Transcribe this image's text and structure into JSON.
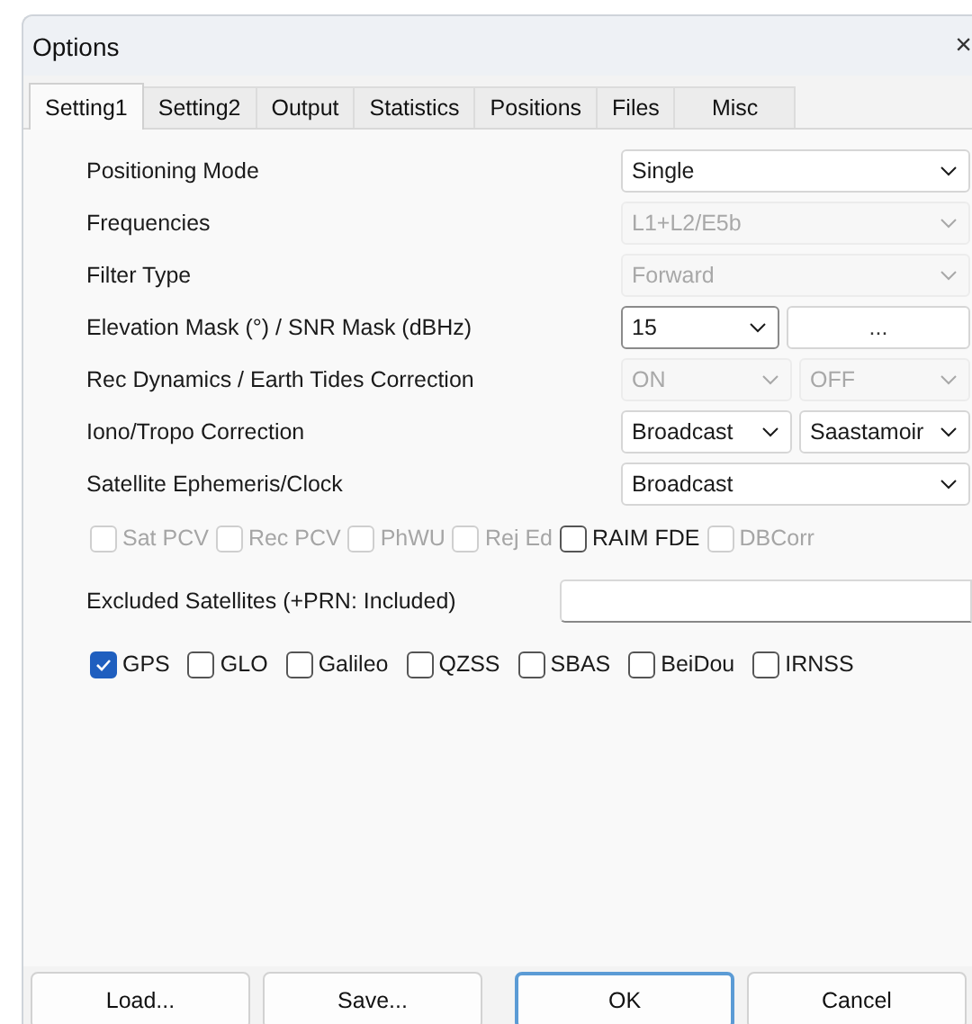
{
  "window": {
    "title": "Options",
    "close": "×"
  },
  "tabs": [
    {
      "label": "Setting1",
      "selected": true
    },
    {
      "label": "Setting2",
      "selected": false
    },
    {
      "label": "Output",
      "selected": false
    },
    {
      "label": "Statistics",
      "selected": false
    },
    {
      "label": "Positions",
      "selected": false
    },
    {
      "label": "Files",
      "selected": false
    },
    {
      "label": "Misc",
      "selected": false
    }
  ],
  "rows": [
    {
      "kind": "select",
      "label": "Positioning Mode",
      "controls": [
        {
          "value": "Single",
          "disabled": false,
          "focused": false
        }
      ]
    },
    {
      "kind": "select",
      "label": "Frequencies",
      "controls": [
        {
          "value": "L1+L2/E5b",
          "disabled": true,
          "focused": false
        }
      ]
    },
    {
      "kind": "select",
      "label": "Filter Type",
      "controls": [
        {
          "value": "Forward",
          "disabled": true,
          "focused": false
        }
      ]
    },
    {
      "kind": "select_button",
      "label": "Elevation Mask (°) / SNR Mask (dBHz)",
      "controls": [
        {
          "value": "15",
          "disabled": false,
          "focused": true
        }
      ],
      "button": "..."
    },
    {
      "kind": "select",
      "label": "Rec Dynamics / Earth Tides Correction",
      "controls": [
        {
          "value": "ON",
          "disabled": true,
          "focused": false
        },
        {
          "value": "OFF",
          "disabled": true,
          "focused": false
        }
      ]
    },
    {
      "kind": "select",
      "label": "Iono/Tropo Correction",
      "controls": [
        {
          "value": "Broadcast",
          "disabled": false,
          "focused": false
        },
        {
          "value": "Saastamoir",
          "disabled": false,
          "focused": false
        }
      ]
    },
    {
      "kind": "select",
      "label": "Satellite Ephemeris/Clock",
      "controls": [
        {
          "value": "Broadcast",
          "disabled": false,
          "focused": false
        }
      ]
    },
    {
      "kind": "checks",
      "items": [
        {
          "label": "Sat PCV",
          "checked": false,
          "disabled": true
        },
        {
          "label": "Rec PCV",
          "checked": false,
          "disabled": true
        },
        {
          "label": "PhWU",
          "checked": false,
          "disabled": true
        },
        {
          "label": "Rej Ed",
          "checked": false,
          "disabled": true
        },
        {
          "label": "RAIM FDE",
          "checked": false,
          "disabled": false
        },
        {
          "label": "DBCorr",
          "checked": false,
          "disabled": true
        }
      ]
    },
    {
      "kind": "text",
      "label": "Excluded Satellites (+PRN: Included)"
    },
    {
      "kind": "checks",
      "items": [
        {
          "label": "GPS",
          "checked": true,
          "disabled": false
        },
        {
          "label": "GLO",
          "checked": false,
          "disabled": false
        },
        {
          "label": "Galileo",
          "checked": false,
          "disabled": false
        },
        {
          "label": "QZSS",
          "checked": false,
          "disabled": false
        },
        {
          "label": "SBAS",
          "checked": false,
          "disabled": false
        },
        {
          "label": "BeiDou",
          "checked": false,
          "disabled": false
        },
        {
          "label": "IRNSS",
          "checked": false,
          "disabled": false
        }
      ]
    }
  ],
  "buttons": [
    {
      "label": "Load...",
      "default": false
    },
    {
      "label": "Save...",
      "default": false
    },
    {
      "label": "OK",
      "default": true
    },
    {
      "label": "Cancel",
      "default": false
    }
  ]
}
